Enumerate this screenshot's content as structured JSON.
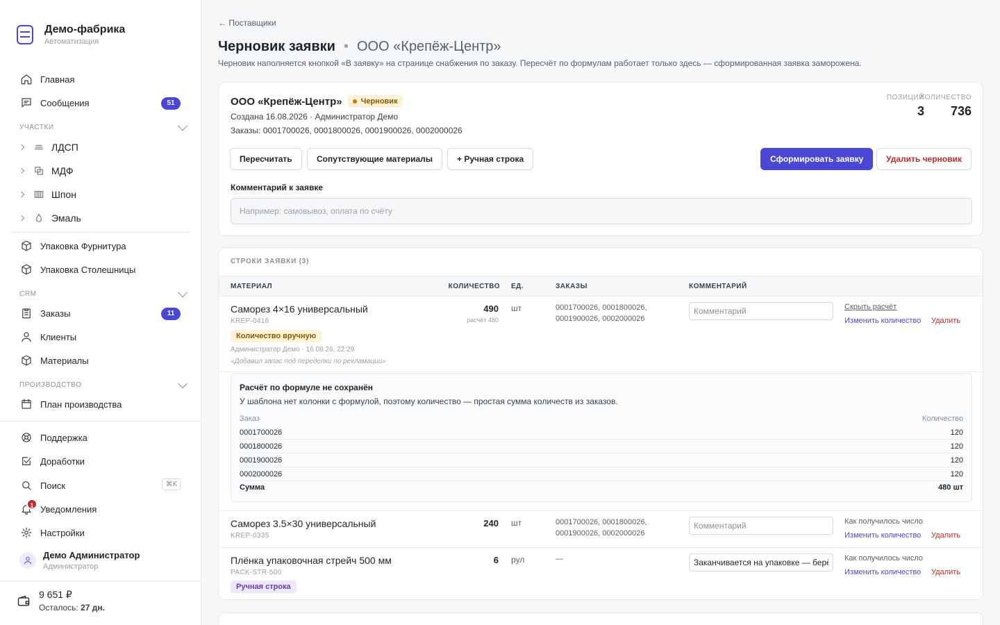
{
  "brand": {
    "title": "Демо-фабрика",
    "subtitle": "Автоматизация"
  },
  "nav": {
    "home": "Главная",
    "messages": "Сообщения",
    "messages_count": "51",
    "sections_label": "Участки",
    "sections": [
      "ЛДСП",
      "МДФ",
      "Шпон",
      "Эмаль"
    ],
    "pack_hardware": "Упаковка Фурнитура",
    "pack_tops": "Упаковка Столешницы",
    "crm_label": "CRM",
    "orders": "Заказы",
    "orders_count": "11",
    "clients": "Клиенты",
    "materials": "Материалы",
    "production_label": "Производство",
    "plan": "План производства",
    "support": "Поддержка",
    "improvements": "Доработки",
    "search": "Поиск",
    "search_kbd": "⌘K",
    "notifications": "Уведомления",
    "notifications_count": "1",
    "settings": "Настройки"
  },
  "user": {
    "name": "Демо Администратор",
    "role": "Администратор"
  },
  "balance": {
    "amount": "9 651 ₽",
    "left_label": "Осталось:",
    "left_value": "27 дн."
  },
  "page": {
    "back": "← Поставщики",
    "title": "Черновик заявки",
    "supplier": "ООО «Крепёж-Центр»",
    "description": "Черновик наполняется кнопкой «В заявку» на странице снабжения по заказу. Пересчёт по формулам работает только здесь — сформированная заявка заморожена."
  },
  "summary": {
    "name": "ООО «Крепёж-Центр»",
    "status": "Черновик",
    "created": "Создана 16.08.2026 · Администратор Демо",
    "orders": "Заказы: 0001700026, 0001800026, 0001900026, 0002000026",
    "positions_label": "Позиций",
    "positions_value": "3",
    "qty_label": "Количество",
    "qty_value": "736",
    "btn_recalc": "Пересчитать",
    "btn_related": "Сопутствующие материалы",
    "btn_manual": "+ Ручная строка",
    "btn_form": "Сформировать заявку",
    "btn_delete": "Удалить черновик",
    "comment_label": "Комментарий к заявке",
    "comment_placeholder": "Например: самовывоз, оплата по счёту"
  },
  "lines": {
    "title": "Строки заявки (3)",
    "headers": {
      "material": "Материал",
      "qty": "Количество",
      "unit": "Ед.",
      "orders": "Заказы",
      "comment": "Комментарий"
    },
    "comment_placeholder": "Комментарий",
    "change_qty": "Изменить количество",
    "delete": "Удалить",
    "rows": [
      {
        "name": "Саморез 4×16 универсальный",
        "code": "KREP-0416",
        "qty": "490",
        "calc": "расчёт 480",
        "unit": "шт",
        "orders": "0001700026, 0001800026, 0001900026, 0002000026",
        "tag": "Количество вручную",
        "author": "Администратор Демо · 16.08.26, 22:29",
        "note": "«Добавил запас под переделки по рекламации»",
        "action": "Скрыть расчёт"
      },
      {
        "name": "Саморез 3.5×30 универсальный",
        "code": "KREP-0335",
        "qty": "240",
        "unit": "шт",
        "orders": "0001700026, 0001800026, 0001900026, 0002000026",
        "action": "Как получилось число"
      },
      {
        "name": "Плёнка упаковочная стрейч 500 мм",
        "code": "PACK-STR-500",
        "qty": "6",
        "unit": "рул",
        "orders": "—",
        "tag": "Ручная строка",
        "comment": "Заканчивается на упаковке — берём",
        "action": "Как получилось число"
      }
    ]
  },
  "calc": {
    "title": "Расчёт по формуле не сохранён",
    "desc": "У шаблона нет колонки с формулой, поэтому количество — простая сумма количеств из заказов.",
    "col_order": "Заказ",
    "col_qty": "Количество",
    "rows": [
      {
        "order": "0001700026",
        "qty": "120"
      },
      {
        "order": "0001800026",
        "qty": "120"
      },
      {
        "order": "0001900026",
        "qty": "120"
      },
      {
        "order": "0002000026",
        "qty": "120"
      }
    ],
    "sum_label": "Сумма",
    "sum_value": "480 шт"
  }
}
